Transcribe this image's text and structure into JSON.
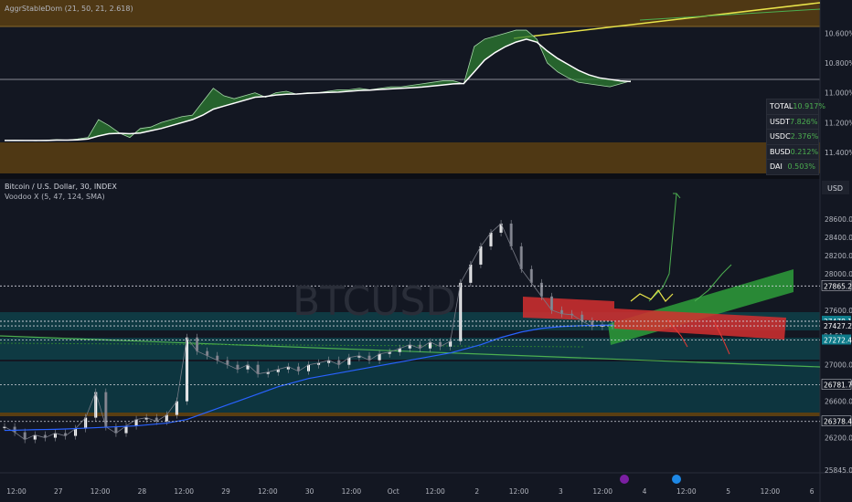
{
  "top_indicator": {
    "label": "AggrStableDom (21, 50, 21, 2.618)",
    "table": [
      {
        "key": "TOTAL",
        "value": "10.917%"
      },
      {
        "key": "USDT",
        "value": "7.826%"
      },
      {
        "key": "USDC",
        "value": "2.376%"
      },
      {
        "key": "BUSD",
        "value": "0.212%"
      },
      {
        "key": "DAI",
        "value": "0.503%"
      }
    ]
  },
  "main_pane": {
    "symbol": "Bitcoin / U.S. Dollar, 30, INDEX",
    "indicator": "Voodoo X (5, 47, 124, SMA)",
    "watermark": "BTCUSD",
    "currency": "USD"
  },
  "chart_data": [
    {
      "type": "line",
      "title": "AggrStableDom (21, 50, 21, 2.618)",
      "x_labels": [
        "12:00",
        "27",
        "12:00",
        "28",
        "12:00",
        "29",
        "12:00",
        "30",
        "12:00",
        "Oct",
        "12:00",
        "2",
        "12:00",
        "3",
        "12:00",
        "4",
        "12:00",
        "5",
        "12:00",
        "6"
      ],
      "y_ticks": [
        "10.600%",
        "10.800%",
        "11.000%",
        "11.200%",
        "11.400%"
      ],
      "y_axis_inverted": true,
      "ylim": [
        10.5,
        11.48
      ],
      "series": [
        {
          "values": [
            11.32,
            11.318,
            11.32,
            11.322,
            11.318,
            11.315,
            11.318,
            11.31,
            11.3,
            11.18,
            11.22,
            11.27,
            11.3,
            11.24,
            11.23,
            11.2,
            11.18,
            11.16,
            11.15,
            11.06,
            10.97,
            11.02,
            11.04,
            11.02,
            11.0,
            11.03,
            11.0,
            10.99,
            11.01,
            11.0,
            11.0,
            10.99,
            10.98,
            10.98,
            10.97,
            10.98,
            10.97,
            10.96,
            10.96,
            10.95,
            10.94,
            10.93,
            10.92,
            10.92,
            10.94,
            10.69,
            10.64,
            10.62,
            10.6,
            10.58,
            10.58,
            10.64,
            10.8,
            10.86,
            10.9,
            10.93,
            10.94,
            10.95,
            10.96,
            10.94,
            10.92
          ]
        },
        {
          "values": [
            11.32,
            11.32,
            11.32,
            11.32,
            11.32,
            11.318,
            11.318,
            11.316,
            11.31,
            11.29,
            11.275,
            11.272,
            11.275,
            11.27,
            11.255,
            11.24,
            11.22,
            11.2,
            11.18,
            11.15,
            11.11,
            11.09,
            11.07,
            11.05,
            11.03,
            11.025,
            11.015,
            11.01,
            11.008,
            11.004,
            11.001,
            10.998,
            10.995,
            10.99,
            10.985,
            10.982,
            10.978,
            10.974,
            10.97,
            10.966,
            10.962,
            10.955,
            10.948,
            10.94,
            10.938,
            10.86,
            10.78,
            10.73,
            10.69,
            10.66,
            10.64,
            10.66,
            10.72,
            10.77,
            10.81,
            10.85,
            10.88,
            10.9,
            10.91,
            10.92,
            10.925
          ]
        }
      ]
    },
    {
      "type": "line",
      "title": "Bitcoin / U.S. Dollar, 30, INDEX",
      "x_labels": [
        "12:00",
        "27",
        "12:00",
        "28",
        "12:00",
        "29",
        "12:00",
        "30",
        "12:00",
        "Oct",
        "12:00",
        "2",
        "12:00",
        "3",
        "12:00",
        "4",
        "12:00",
        "5",
        "12:00",
        "6"
      ],
      "y_ticks": [
        28600,
        28400,
        28200,
        28000,
        27600,
        27000,
        26800,
        26600,
        26200,
        25845
      ],
      "ylim": [
        25845,
        28780
      ],
      "price_labels": [
        "27865.26",
        "27478.19",
        "27427.20",
        "04:51",
        "27272.42",
        "26781.75",
        "26378.45"
      ],
      "series": [
        {
          "values": [
            26320,
            26260,
            26180,
            26230,
            26200,
            26250,
            26220,
            26300,
            26420,
            26700,
            26320,
            26250,
            26330,
            26400,
            26420,
            26380,
            26450,
            26600,
            27300,
            27150,
            27100,
            27050,
            27000,
            26950,
            27000,
            26900,
            26920,
            26950,
            26980,
            26930,
            27000,
            27020,
            27050,
            27000,
            27080,
            27100,
            27050,
            27120,
            27140,
            27180,
            27220,
            27180,
            27250,
            27200,
            27260,
            27900,
            28100,
            28300,
            28450,
            28550,
            28300,
            28050,
            27900,
            27750,
            27600,
            27560,
            27550,
            27480,
            27420,
            27440,
            27430
          ]
        },
        {
          "values": [
            26280,
            26282,
            26285,
            26288,
            26290,
            26292,
            26296,
            26300,
            26305,
            26310,
            26315,
            26320,
            26325,
            26330,
            26340,
            26350,
            26360,
            26380,
            26400,
            26440,
            26480,
            26520,
            26560,
            26600,
            26640,
            26680,
            26720,
            26760,
            26790,
            26820,
            26850,
            26870,
            26890,
            26910,
            26930,
            26950,
            26970,
            26990,
            27010,
            27030,
            27050,
            27070,
            27090,
            27110,
            27130,
            27160,
            27190,
            27220,
            27260,
            27300,
            27330,
            27360,
            27380,
            27400,
            27410,
            27420,
            27425,
            27430,
            27432,
            27434,
            27435
          ]
        }
      ],
      "levels": [
        27865.26,
        27478.19,
        27427.2,
        27272.42,
        26781.75,
        26378.45
      ]
    }
  ]
}
